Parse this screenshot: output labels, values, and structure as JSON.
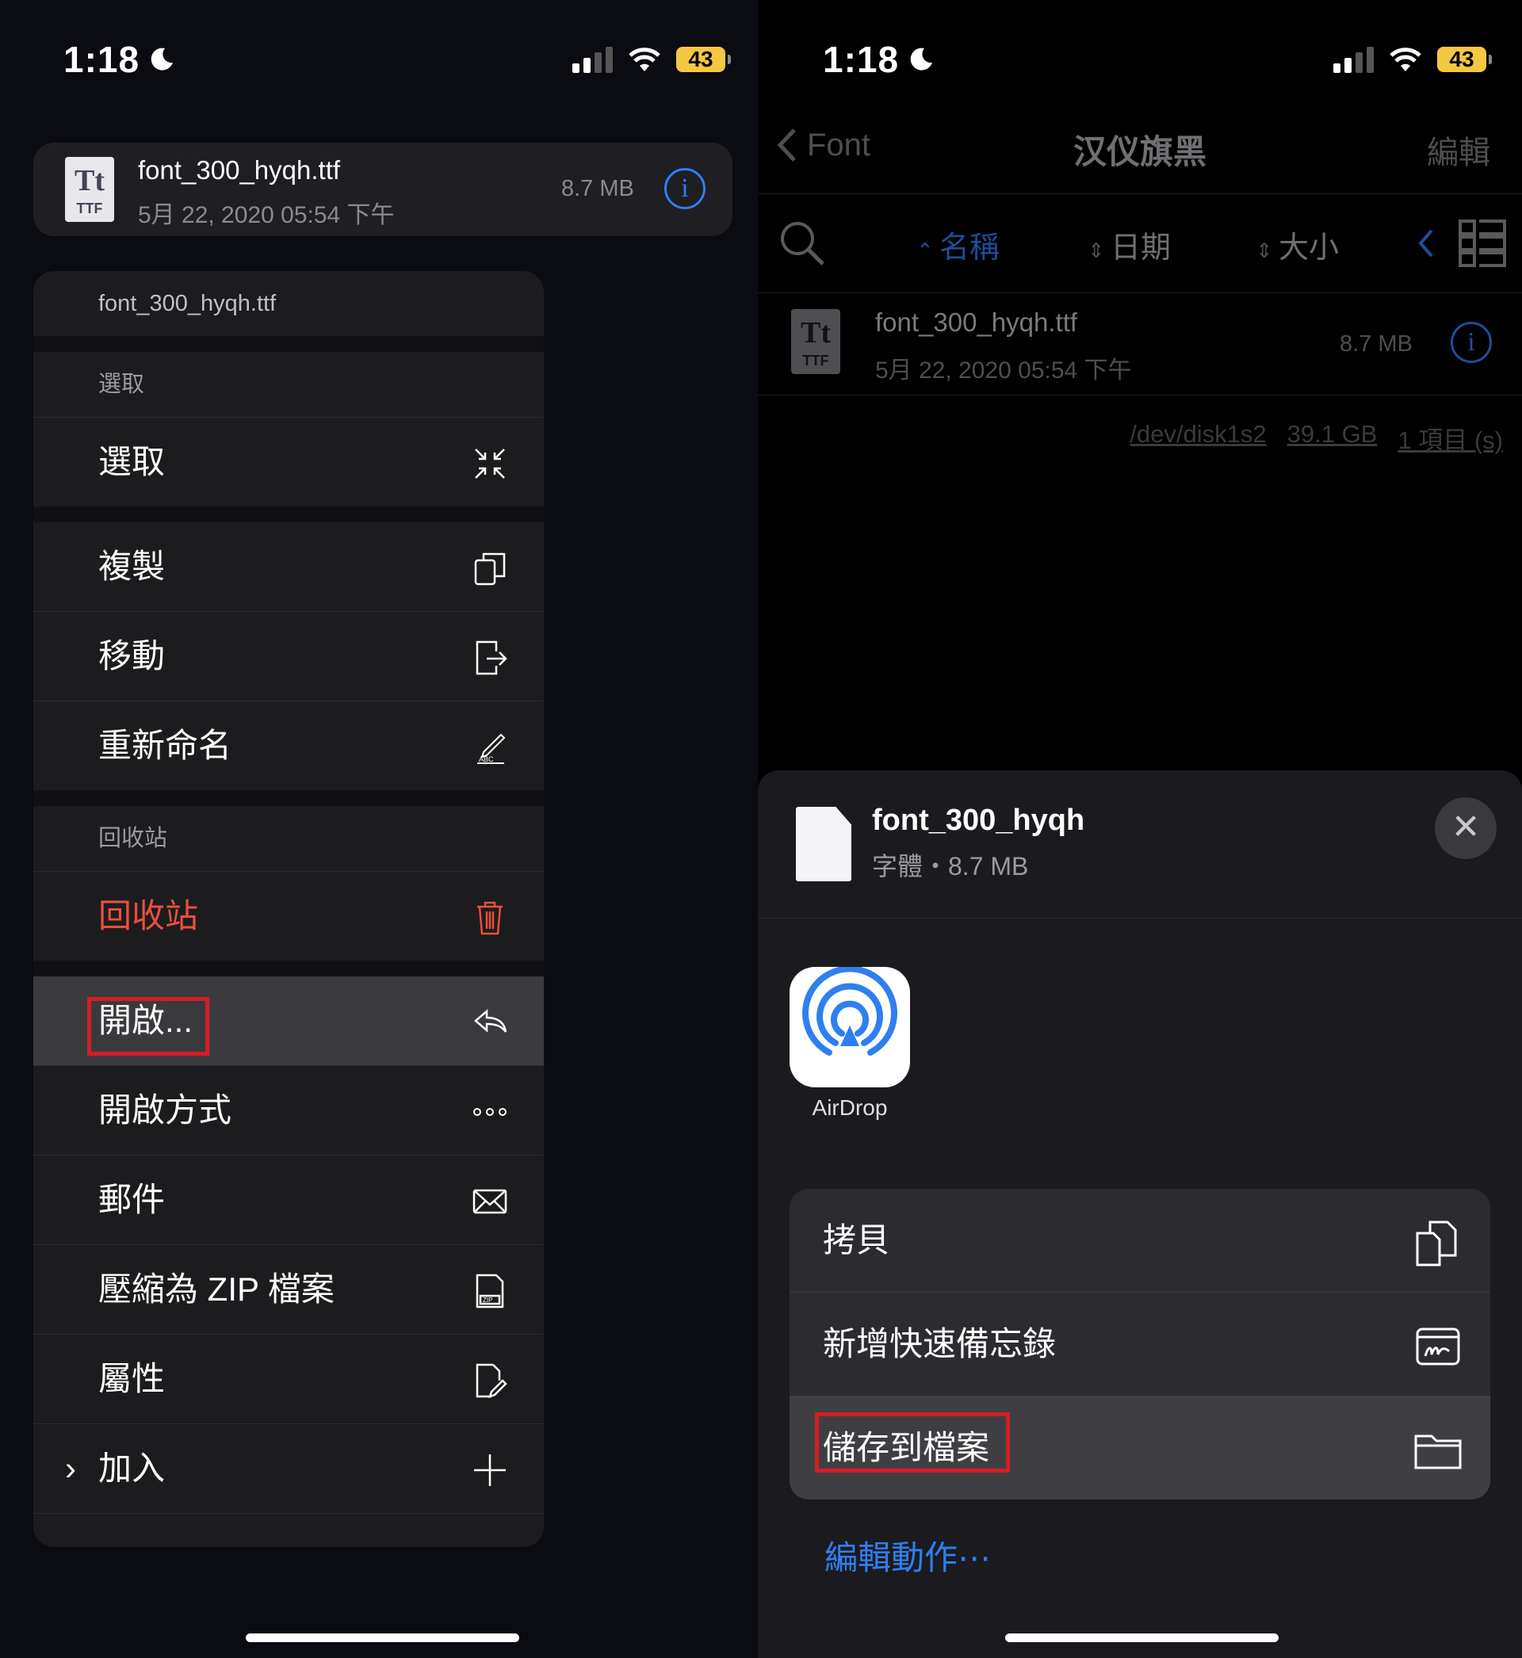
{
  "status": {
    "time": "1:18",
    "battery": "43"
  },
  "left": {
    "file": {
      "name": "font_300_hyqh.ttf",
      "date": "5月 22, 2020 05:54 下午",
      "size": "8.7 MB",
      "icon_tt": "Tt",
      "icon_ext": "TTF"
    },
    "menu": {
      "header": "font_300_hyqh.ttf",
      "section_select": "選取",
      "select": "選取",
      "copy": "複製",
      "move": "移動",
      "rename": "重新命名",
      "section_trash": "回收站",
      "trash": "回收站",
      "open": "開啟...",
      "open_with": "開啟方式",
      "mail": "郵件",
      "zip": "壓縮為 ZIP 檔案",
      "properties": "屬性",
      "add": "加入"
    }
  },
  "right": {
    "nav": {
      "back": "Font",
      "title": "汉仪旗黑",
      "edit": "編輯"
    },
    "sort": {
      "name": "名稱",
      "date": "日期",
      "size": "大小"
    },
    "file": {
      "name": "font_300_hyqh.ttf",
      "date": "5月 22, 2020 05:54 下午",
      "size": "8.7 MB",
      "icon_tt": "Tt",
      "icon_ext": "TTF"
    },
    "footer": {
      "disk": "/dev/disk1s2",
      "free": "39.1 GB",
      "count": "1 項目 (s)"
    },
    "sheet": {
      "title": "font_300_hyqh",
      "subtitle": "字體・8.7 MB",
      "airdrop_label": "AirDrop",
      "actions": {
        "copy": "拷貝",
        "quick_note": "新增快速備忘錄",
        "save_to_files": "儲存到檔案"
      },
      "edit_actions": "編輯動作⋯"
    }
  },
  "colors": {
    "accent": "#2f7ff0",
    "danger": "#ea4f3d",
    "highlight_box": "#d41e26",
    "battery": "#f5c843"
  },
  "icons": [
    "moon-icon",
    "signal-icon",
    "wifi-icon",
    "battery-icon",
    "ttf-file-icon",
    "info-icon",
    "select-icon",
    "copy-icon",
    "move-icon",
    "rename-icon",
    "trash-icon",
    "open-icon",
    "more-icon",
    "mail-icon",
    "zip-icon",
    "properties-icon",
    "add-icon",
    "back-chevron-icon",
    "search-icon",
    "sort-icon",
    "grid-view-icon",
    "document-icon",
    "close-icon",
    "airdrop-icon",
    "quick-note-icon",
    "folder-icon"
  ]
}
